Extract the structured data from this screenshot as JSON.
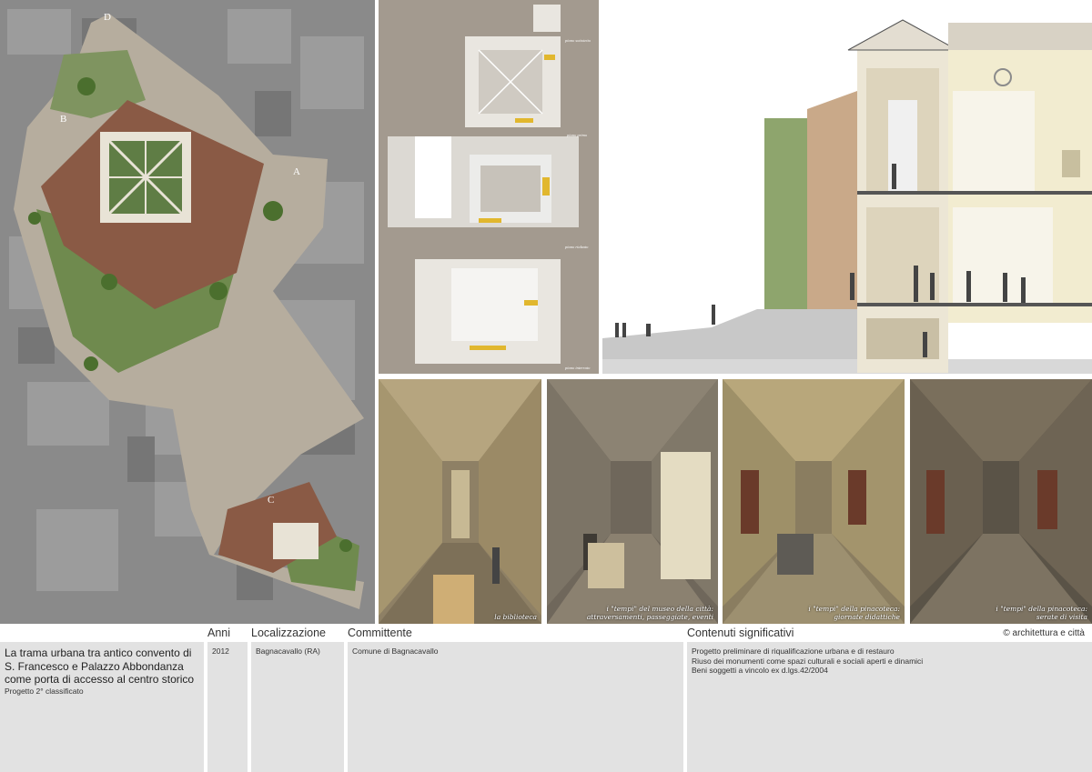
{
  "site_plan": {
    "labels": [
      "D",
      "B",
      "A",
      "C"
    ]
  },
  "axonometry": {
    "floors": [
      "piano sottotetto",
      "piano primo",
      "piano rialzato",
      "piano interrato"
    ]
  },
  "renders": [
    {
      "caption": "la biblioteca"
    },
    {
      "caption": "i \"tempi\" del museo della città:\nattraversamenti, passeggiate, eventi"
    },
    {
      "caption": "i \"tempi\" della pinacoteca:\ngiornate didattiche"
    },
    {
      "caption": "i \"tempi\" della pinacoteca:\nserate di visita"
    }
  ],
  "info": {
    "headers": {
      "years": "Anni",
      "location": "Localizzazione",
      "client": "Committente",
      "contents": "Contenuti significativi"
    },
    "copyright": "© architettura e città",
    "title_lines": [
      "La trama urbana tra antico convento di",
      "S. Francesco e Palazzo Abbondanza",
      "come porta di accesso al centro storico"
    ],
    "subtitle": "Progetto 2° classificato",
    "year": "2012",
    "location": "Bagnacavallo (RA)",
    "client": "Comune di Bagnacavallo",
    "contents": [
      "Progetto preliminare di riqualificazione urbana e di restauro",
      "Riuso dei monumenti come spazi culturali e sociali aperti e dinamici",
      "Beni soggetti a vincolo ex d.lgs.42/2004"
    ]
  }
}
